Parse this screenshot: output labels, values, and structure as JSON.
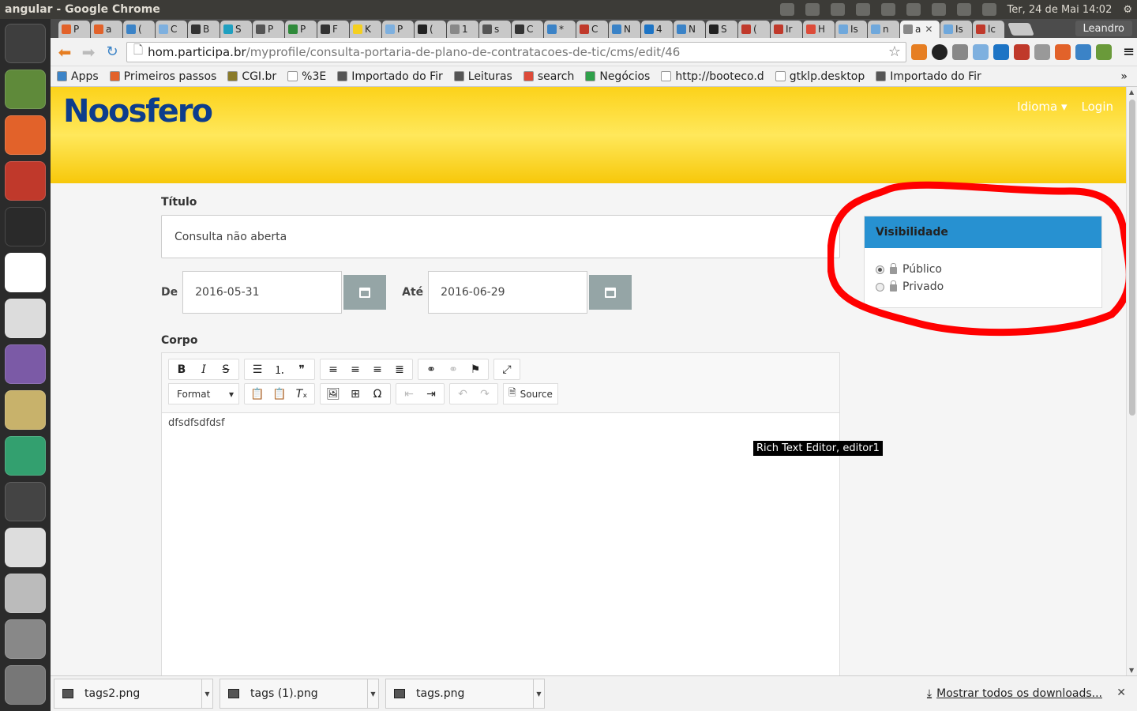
{
  "system": {
    "window_title": "angular - Google Chrome",
    "datetime": "Ter, 24 de Mai 14:02"
  },
  "launcher": {
    "items": [
      {
        "name": "dash",
        "color": "#3e3e3e"
      },
      {
        "name": "software-updater",
        "color": "#5f8a3a"
      },
      {
        "name": "files",
        "color": "#e2622a"
      },
      {
        "name": "system-settings",
        "color": "#c0392b"
      },
      {
        "name": "terminal",
        "color": "#2a2a2a"
      },
      {
        "name": "chrome",
        "color": "#ffffff"
      },
      {
        "name": "text-editor",
        "color": "#dcdcdc"
      },
      {
        "name": "pidgin",
        "color": "#7b5aa6"
      },
      {
        "name": "speaker",
        "color": "#c8b26b"
      },
      {
        "name": "atom",
        "color": "#33a06f"
      },
      {
        "name": "workspace-switcher",
        "color": "#444444"
      },
      {
        "name": "disc",
        "color": "#dddddd"
      },
      {
        "name": "drive",
        "color": "#bbbbbb"
      },
      {
        "name": "drive-2",
        "color": "#888888"
      },
      {
        "name": "trash",
        "color": "#777777"
      }
    ]
  },
  "tabs": [
    {
      "label": "P",
      "color": "#e2622a"
    },
    {
      "label": "a",
      "color": "#e2622a"
    },
    {
      "label": "(",
      "color": "#3b83c7"
    },
    {
      "label": "C",
      "color": "#7eb0df"
    },
    {
      "label": "B",
      "color": "#333333"
    },
    {
      "label": "S",
      "color": "#20a0c0"
    },
    {
      "label": "P",
      "color": "#555555"
    },
    {
      "label": "P",
      "color": "#2f8a3a"
    },
    {
      "label": "F",
      "color": "#333333"
    },
    {
      "label": "K",
      "color": "#f5d020"
    },
    {
      "label": "P",
      "color": "#7eb0df"
    },
    {
      "label": "(",
      "color": "#222222"
    },
    {
      "label": "1",
      "color": "#888888"
    },
    {
      "label": "s",
      "color": "#555555"
    },
    {
      "label": "C",
      "color": "#333333"
    },
    {
      "label": "*",
      "color": "#3b83c7"
    },
    {
      "label": "C",
      "color": "#c0392b"
    },
    {
      "label": "N",
      "color": "#3b83c7"
    },
    {
      "label": "4",
      "color": "#1d74c5"
    },
    {
      "label": "N",
      "color": "#3b83c7"
    },
    {
      "label": "S",
      "color": "#222222"
    },
    {
      "label": "(",
      "color": "#c0392b"
    },
    {
      "label": "Ir",
      "color": "#c0392b"
    },
    {
      "label": "H",
      "color": "#dd4b39"
    },
    {
      "label": "Is",
      "color": "#6fa8dc"
    },
    {
      "label": "n",
      "color": "#6fa8dc"
    },
    {
      "label": "a",
      "color": "#888888",
      "active": true
    },
    {
      "label": "Is",
      "color": "#6fa8dc"
    },
    {
      "label": "lc",
      "color": "#c0392b"
    }
  ],
  "browser": {
    "profile": "Leandro",
    "url_host": "hom.participa.br",
    "url_path": "/myprofile/consulta-portaria-de-plano-de-contratacoes-de-tic/cms/edit/46",
    "bookmarks": [
      {
        "label": "Apps",
        "color": "#3b83c7"
      },
      {
        "label": "Primeiros passos",
        "color": "#e2622a"
      },
      {
        "label": "CGI.br",
        "color": "#8a7b2a"
      },
      {
        "label": "%3E",
        "color": "#ffffff"
      },
      {
        "label": "Importado do Fir",
        "color": "#555555"
      },
      {
        "label": "Leituras",
        "color": "#555555"
      },
      {
        "label": "search",
        "color": "#dd4b39"
      },
      {
        "label": "Negócios",
        "color": "#2fa04a"
      },
      {
        "label": "http://booteco.d",
        "color": "#ffffff"
      },
      {
        "label": "gtklp.desktop",
        "color": "#ffffff"
      },
      {
        "label": "Importado do Fir",
        "color": "#555555"
      }
    ],
    "overflow": "»"
  },
  "site": {
    "logo": "Noosfero",
    "nav": {
      "language": "Idioma",
      "login": "Login"
    }
  },
  "form": {
    "title_label": "Título",
    "title_value": "Consulta não aberta",
    "from_label": "De",
    "from_value": "2016-05-31",
    "to_label": "Até",
    "to_value": "2016-06-29",
    "body_label": "Corpo",
    "format_label": "Format",
    "source_label": "Source",
    "body_text": "dfsdfsdfdsf",
    "tooltip": "Rich Text Editor, editor1"
  },
  "visibility": {
    "title": "Visibilidade",
    "options": [
      {
        "label": "Público",
        "selected": true
      },
      {
        "label": "Privado",
        "selected": false
      }
    ]
  },
  "downloads": {
    "items": [
      "tags2.png",
      "tags (1).png",
      "tags.png"
    ],
    "show_all": "Mostrar todos os downloads..."
  },
  "colors": {
    "banner": "#fcd21a",
    "logo": "#0d3d8c",
    "vis_header": "#2791d1",
    "annotation": "#ff0000"
  }
}
